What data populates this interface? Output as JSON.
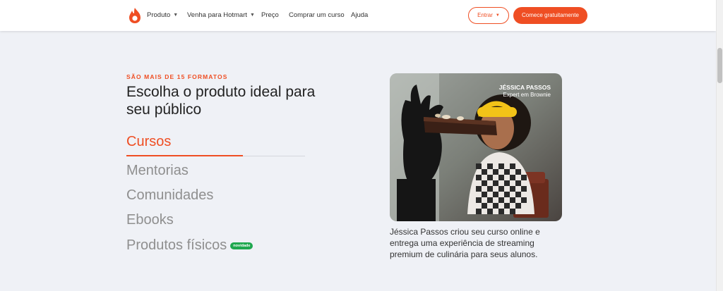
{
  "header": {
    "nav": [
      {
        "label": "Produto",
        "has_dropdown": true
      },
      {
        "label": "Venha para Hotmart",
        "has_dropdown": true
      },
      {
        "label": "Preço",
        "has_dropdown": false
      },
      {
        "label": "Comprar um curso",
        "has_dropdown": false
      },
      {
        "label": "Ajuda",
        "has_dropdown": false
      }
    ],
    "login_label": "Entrar",
    "cta_label": "Comece gratuitamente"
  },
  "section": {
    "eyebrow": "SÃO MAIS DE 15 FORMATOS",
    "title": "Escolha o produto ideal para seu público",
    "tabs": [
      {
        "label": "Cursos",
        "active": true
      },
      {
        "label": "Mentorias",
        "active": false
      },
      {
        "label": "Comunidades",
        "active": false
      },
      {
        "label": "Ebooks",
        "active": false
      },
      {
        "label": "Produtos físicos",
        "active": false,
        "badge": "novidade"
      }
    ]
  },
  "feature": {
    "person_name": "JÉSSICA PASSOS",
    "person_role": "Expert em Brownie",
    "description": "Jéssica Passos criou seu curso online e entrega uma experiência de streaming premium de culinária para seus alunos."
  },
  "colors": {
    "accent": "#ef4e23",
    "badge": "#1fa74f",
    "background": "#eff1f6"
  }
}
